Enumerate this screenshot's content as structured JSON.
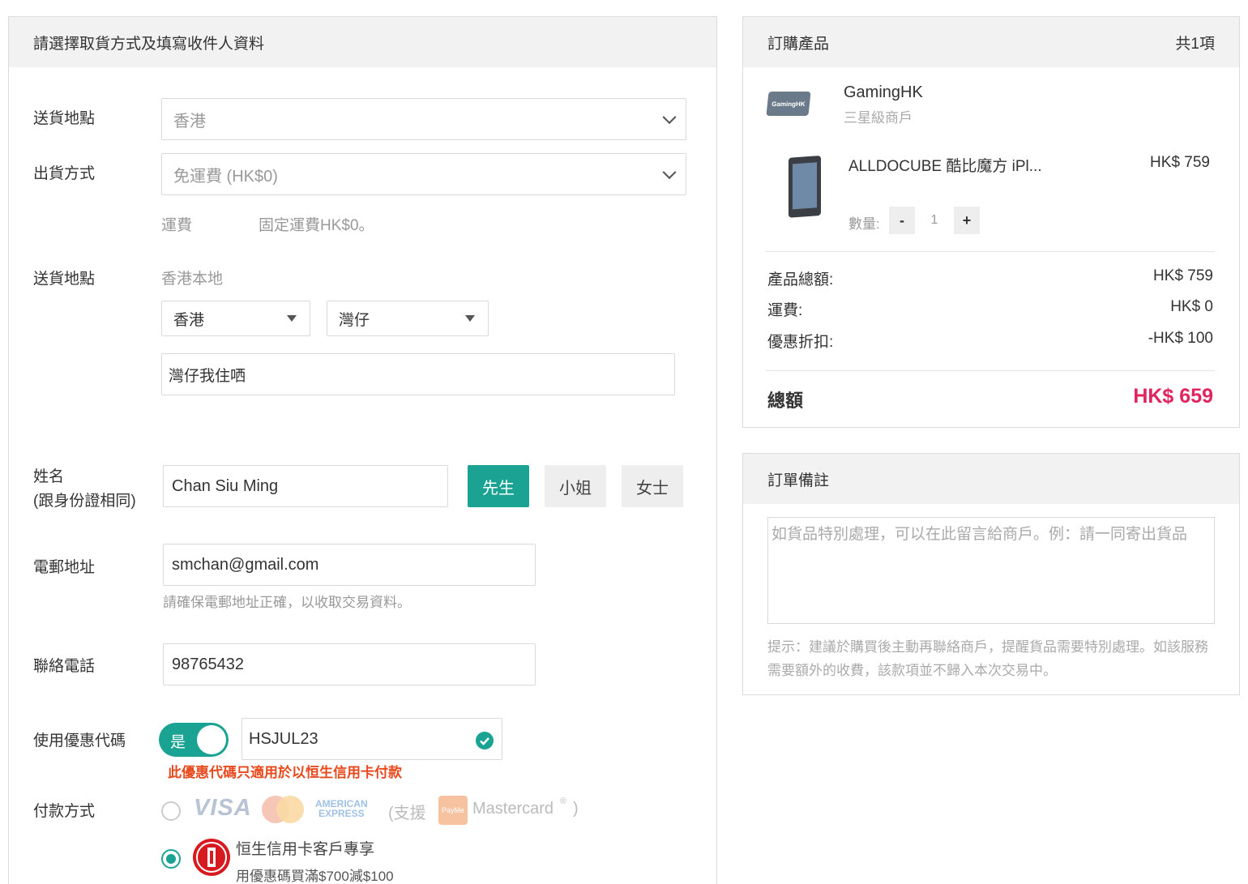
{
  "left": {
    "header": "請選擇取貨方式及填寫收件人資料",
    "delivery_location_label": "送貨地點",
    "delivery_location_value": "香港",
    "shipping_method_label": "出貨方式",
    "shipping_method_value": "免運費 (HK$0)",
    "fee_label": "運費",
    "fee_value": "固定運費HK$0。",
    "address_label": "送貨地點",
    "address_region": "香港本地",
    "area1": "香港",
    "area2": "灣仔",
    "address_value": "灣仔我住哂",
    "name_label_1": "姓名",
    "name_label_2": "(跟身份證相同)",
    "name_value": "Chan Siu Ming",
    "titles": [
      "先生",
      "小姐",
      "女士"
    ],
    "email_label": "電郵地址",
    "email_value": "smchan@gmail.com",
    "email_hint": "請確保電郵地址正確，以收取交易資料。",
    "phone_label": "聯絡電話",
    "phone_value": "98765432",
    "coupon_label": "使用優惠代碼",
    "coupon_toggle": "是",
    "coupon_value": "HSJUL23",
    "coupon_warning": "此優惠代碼只適用於以恒生信用卡付款",
    "payment_label": "付款方式",
    "visa": "VISA",
    "amex_1": "AMERICAN",
    "amex_2": "EXPRESS",
    "support_open": "(支援",
    "payme": "PayMe",
    "mastercard": "Mastercard",
    "reg": "®",
    "support_close": ")",
    "hangseng_title": "恒生信用卡客戶專享",
    "hangseng_sub": "用優惠碼買滿$700減$100"
  },
  "order": {
    "header": "訂購產品",
    "count": "共1項",
    "merchant_logo": "GamingHK",
    "merchant_name": "GamingHK",
    "merchant_rating": "三星級商戶",
    "product_name": "ALLDOCUBE 酷比魔方 iPl...",
    "product_price": "HK$ 759",
    "qty_label": "數量:",
    "qty_minus": "-",
    "qty_value": "1",
    "qty_plus": "+",
    "subtotal_label": "產品總額:",
    "subtotal_value": "HK$ 759",
    "shipping_label": "運費:",
    "shipping_value": "HK$ 0",
    "discount_label": "優惠折扣:",
    "discount_value": "-HK$ 100",
    "total_label": "總額",
    "total_value": "HK$ 659",
    "accent": "#e0245e"
  },
  "notes": {
    "header": "訂單備註",
    "placeholder": "如貨品特別處理，可以在此留言給商戶。例：請一同寄出貨品",
    "tip": "提示：建議於購買後主動再聯絡商戶，提醒貨品需要特別處理。如該服務需要額外的收費，該款項並不歸入本次交易中。"
  },
  "colors": {
    "teal": "#1aa392",
    "warning": "#e8491d"
  }
}
